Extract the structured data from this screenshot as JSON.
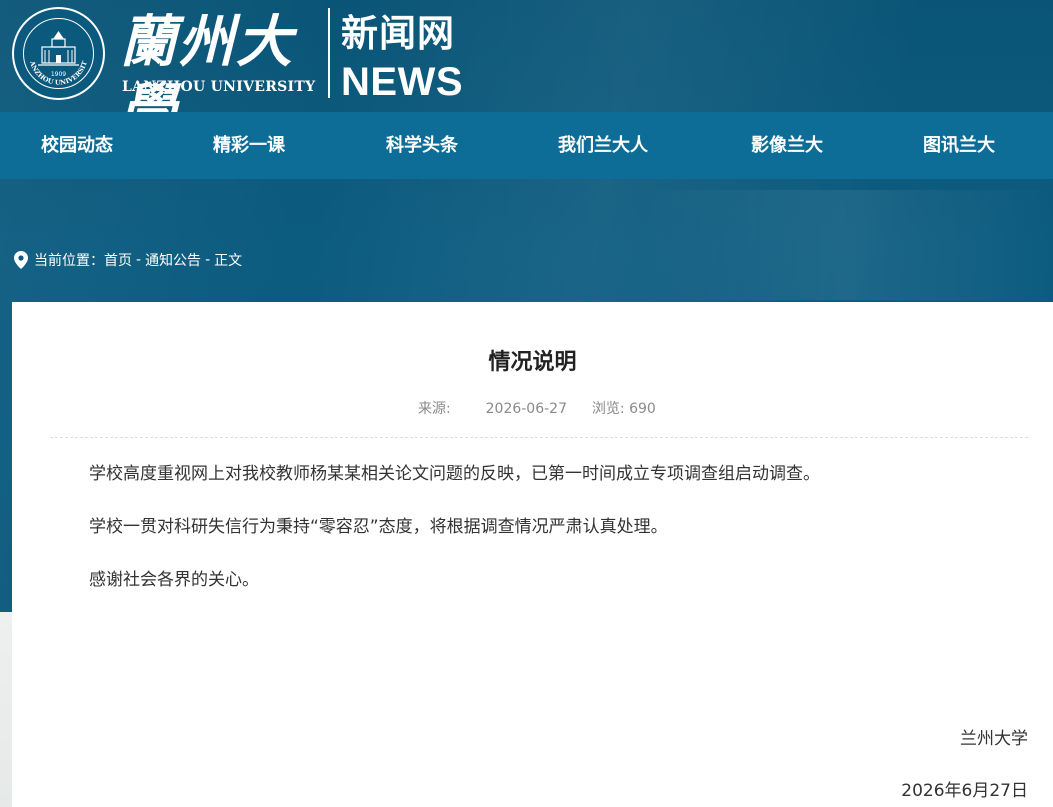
{
  "header": {
    "logo_cn": "蘭州大學",
    "logo_en": "LANZHOU UNIVERSITY",
    "site_name": "新闻网",
    "site_en": "NEWS",
    "seal_year": "1909",
    "seal_text": "LANZHOU UNIVERSITY"
  },
  "nav": {
    "items": [
      {
        "label": "校园动态"
      },
      {
        "label": "精彩一课"
      },
      {
        "label": "科学头条"
      },
      {
        "label": "我们兰大人"
      },
      {
        "label": "影像兰大"
      },
      {
        "label": "图讯兰大"
      }
    ]
  },
  "breadcrumb": {
    "prefix": "当前位置：",
    "home": "首页",
    "category": "通知公告",
    "current": "正文",
    "separator": "-"
  },
  "article": {
    "title": "情况说明",
    "source_label": "来源:",
    "date": "2026-06-27",
    "views_label": "浏览:",
    "views": "690",
    "paragraphs": [
      "学校高度重视网上对我校教师杨某某相关论文问题的反映，已第一时间成立专项调查组启动调查。",
      "学校一贯对科研失信行为秉持“零容忍”态度，将根据调查情况严肃认真处理。",
      "感谢社会各界的关心。"
    ],
    "signature": "兰州大学",
    "sign_date": "2026年6月27日"
  },
  "colors": {
    "header_bg": "#0b5a7e",
    "nav_bg": "#0d6d97",
    "text": "#333333",
    "meta": "#8a8a8a"
  }
}
